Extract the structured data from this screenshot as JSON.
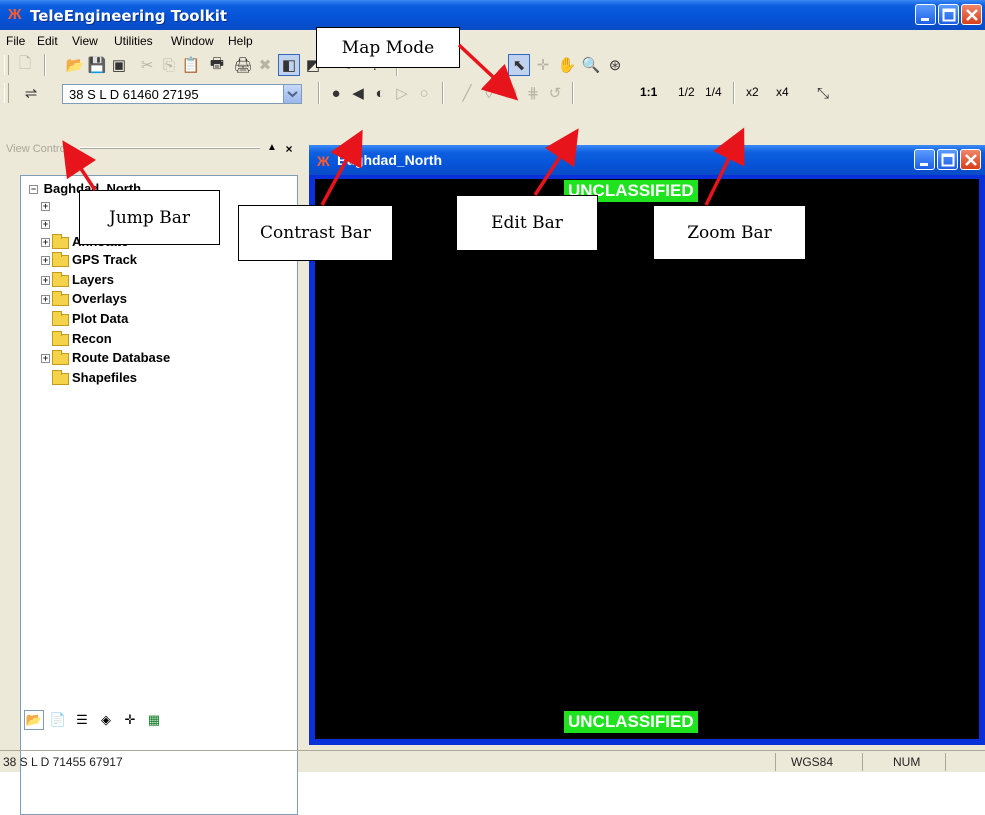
{
  "app": {
    "title": "TeleEngineering Toolkit",
    "brand_color": "#0552d6"
  },
  "menu": [
    "File",
    "Edit",
    "View",
    "Utilities",
    "Window",
    "Help"
  ],
  "jump": {
    "value": "38 S L D 61460 27195"
  },
  "zoom": {
    "one_to_one": "1:1",
    "half": "1/2",
    "quarter": "1/4",
    "x2": "x2",
    "x4": "x4"
  },
  "view_control": {
    "title": "View Control",
    "root": "Baghdad_North",
    "items": [
      {
        "label": "Annotate",
        "expandable": true
      },
      {
        "label": "GPS Track",
        "expandable": true
      },
      {
        "label": "Layers",
        "expandable": true
      },
      {
        "label": "Overlays",
        "expandable": true
      },
      {
        "label": "Plot Data",
        "expandable": false
      },
      {
        "label": "Recon",
        "expandable": false
      },
      {
        "label": "Route Database",
        "expandable": true
      },
      {
        "label": "Shapefiles",
        "expandable": false
      }
    ]
  },
  "map_window": {
    "title": "Baghdad_North",
    "classification": "UNCLASSIFIED",
    "classification_color": "#1fe31f"
  },
  "status": {
    "coords": "38 S L D 71455 67917",
    "datum": "WGS84",
    "num": "NUM"
  },
  "callouts": {
    "map_mode": "Map Mode",
    "jump_bar": "Jump Bar",
    "contrast_bar": "Contrast Bar",
    "edit_bar": "Edit Bar",
    "zoom_bar": "Zoom Bar",
    "arrow_color": "#e8141b"
  }
}
